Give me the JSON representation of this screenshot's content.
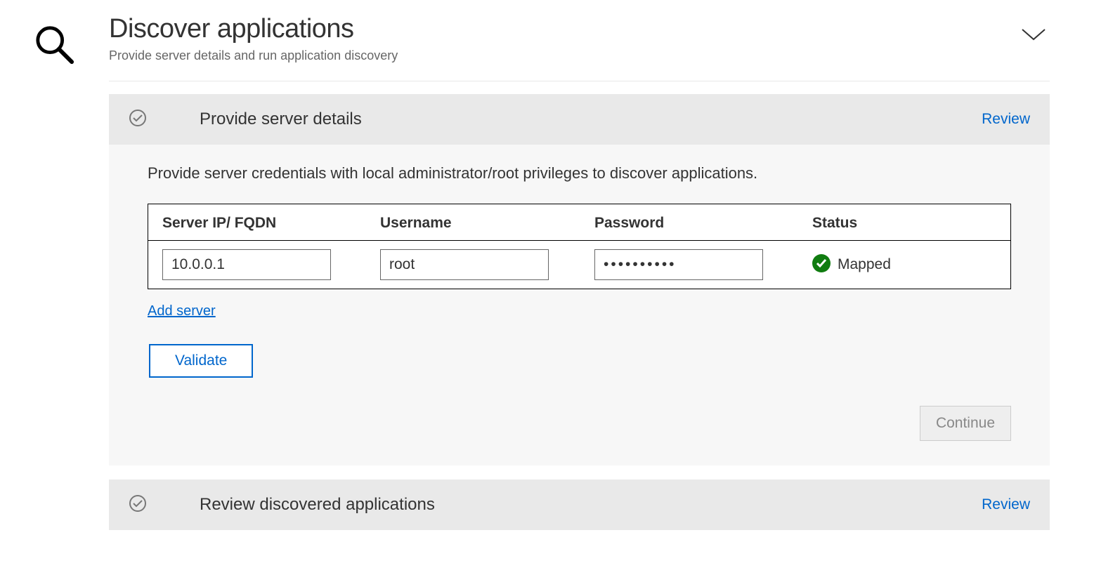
{
  "header": {
    "title": "Discover applications",
    "subtitle": "Provide server details and run application discovery"
  },
  "section1": {
    "title": "Provide server details",
    "review_label": "Review",
    "instruction": "Provide server credentials with local administrator/root privileges to discover applications.",
    "columns": {
      "ip": "Server IP/ FQDN",
      "username": "Username",
      "password": "Password",
      "status": "Status"
    },
    "servers": [
      {
        "ip": "10.0.0.1",
        "username": "root",
        "password_display": "••••••••••",
        "status": "Mapped"
      }
    ],
    "add_server_label": "Add server",
    "validate_label": "Validate",
    "continue_label": "Continue"
  },
  "section2": {
    "title": "Review discovered applications",
    "review_label": "Review"
  }
}
